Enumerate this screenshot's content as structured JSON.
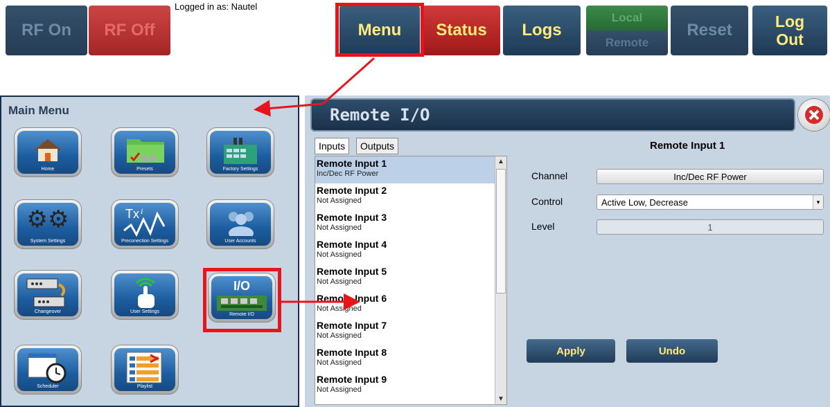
{
  "topbar": {
    "rf_on": "RF On",
    "rf_off": "RF Off",
    "logged_in": "Logged in as: Nautel",
    "menu": "Menu",
    "status": "Status",
    "logs": "Logs",
    "local": "Local",
    "remote": "Remote",
    "reset": "Reset",
    "logout_line1": "Log",
    "logout_line2": "Out"
  },
  "main_menu": {
    "title": "Main Menu",
    "tiles": [
      {
        "label": "Home",
        "icon": "home-icon"
      },
      {
        "label": "Presets",
        "icon": "folder-icon"
      },
      {
        "label": "Factory Settings",
        "icon": "factory-icon"
      },
      {
        "label": "System Settings",
        "icon": "gears-icon"
      },
      {
        "label": "Preconection Settings",
        "icon": "txi-waveform-icon"
      },
      {
        "label": "User Accounts",
        "icon": "users-icon"
      },
      {
        "label": "Changeover",
        "icon": "changeover-icon"
      },
      {
        "label": "User Settings",
        "icon": "touch-icon"
      },
      {
        "label": "Remote I/O",
        "icon": "io-board-icon",
        "tile_text": "I/O"
      },
      {
        "label": "Scheduler",
        "icon": "calendar-clock-icon"
      },
      {
        "label": "Playlist",
        "icon": "playlist-icon"
      }
    ]
  },
  "remote_io": {
    "title": "Remote I/O",
    "tabs": [
      "Inputs",
      "Outputs"
    ],
    "inputs": [
      {
        "name": "Remote Input 1",
        "assignment": "Inc/Dec RF Power"
      },
      {
        "name": "Remote Input 2",
        "assignment": "Not Assigned"
      },
      {
        "name": "Remote Input 3",
        "assignment": "Not Assigned"
      },
      {
        "name": "Remote Input 4",
        "assignment": "Not Assigned"
      },
      {
        "name": "Remote Input 5",
        "assignment": "Not Assigned"
      },
      {
        "name": "Remote Input 6",
        "assignment": "Not Assigned"
      },
      {
        "name": "Remote Input 7",
        "assignment": "Not Assigned"
      },
      {
        "name": "Remote Input 8",
        "assignment": "Not Assigned"
      },
      {
        "name": "Remote Input 9",
        "assignment": "Not Assigned"
      }
    ],
    "detail": {
      "heading": "Remote Input 1",
      "channel_label": "Channel",
      "channel_value": "Inc/Dec RF Power",
      "control_label": "Control",
      "control_value": "Active Low, Decrease",
      "level_label": "Level",
      "level_value": "1"
    },
    "apply": "Apply",
    "undo": "Undo"
  },
  "colors": {
    "annotation_red": "#e8141b",
    "navy": "#1f3a55",
    "yellow_text": "#ffec7a",
    "panel_bg": "#c7d5e3",
    "selection": "#bcd0e8"
  }
}
